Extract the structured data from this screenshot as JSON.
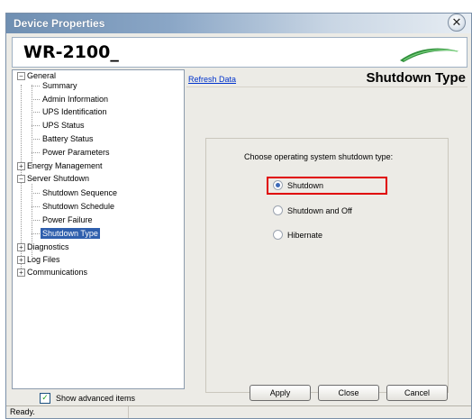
{
  "window": {
    "title": "Device Properties",
    "close_glyph": "✕"
  },
  "header": {
    "model": "WR-2100_",
    "logo_icon": "green-swoosh-logo"
  },
  "tree": {
    "general": "General",
    "summary": "Summary",
    "admin_information": "Admin Information",
    "ups_identification": "UPS Identification",
    "ups_status": "UPS Status",
    "battery_status": "Battery Status",
    "power_parameters": "Power Parameters",
    "energy_management": "Energy Management",
    "server_shutdown": "Server Shutdown",
    "shutdown_sequence": "Shutdown Sequence",
    "shutdown_schedule": "Shutdown Schedule",
    "power_failure": "Power Failure",
    "shutdown_type": "Shutdown Type",
    "diagnostics": "Diagnostics",
    "log_files": "Log Files",
    "communications": "Communications",
    "expanded_glyph": "−",
    "collapsed_glyph": "+"
  },
  "content": {
    "refresh_link": "Refresh Data",
    "section_title": "Shutdown Type",
    "prompt": "Choose operating system shutdown type:",
    "options": [
      {
        "label": "Shutdown",
        "selected": true
      },
      {
        "label": "Shutdown and Off",
        "selected": false
      },
      {
        "label": "Hibernate",
        "selected": false
      }
    ],
    "highlight_color": "#e00000"
  },
  "footer": {
    "show_advanced_label": "Show advanced items",
    "show_advanced_checked": true,
    "check_glyph": "✓",
    "apply_label": "Apply",
    "close_label": "Close",
    "cancel_label": "Cancel"
  },
  "status": {
    "text": "Ready."
  },
  "colors": {
    "selection": "#2f5fad",
    "link": "#0033cc",
    "window_bg": "#ecebe6"
  }
}
